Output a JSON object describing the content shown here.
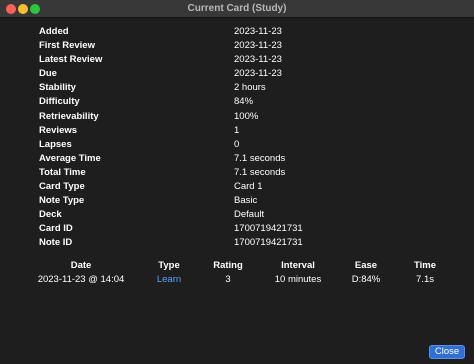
{
  "window": {
    "title": "Current Card (Study)"
  },
  "stats": [
    {
      "label": "Added",
      "value": "2023-11-23"
    },
    {
      "label": "First Review",
      "value": "2023-11-23"
    },
    {
      "label": "Latest Review",
      "value": "2023-11-23"
    },
    {
      "label": "Due",
      "value": "2023-11-23"
    },
    {
      "label": "Stability",
      "value": "2 hours"
    },
    {
      "label": "Difficulty",
      "value": "84%"
    },
    {
      "label": "Retrievability",
      "value": "100%"
    },
    {
      "label": "Reviews",
      "value": "1"
    },
    {
      "label": "Lapses",
      "value": "0"
    },
    {
      "label": "Average Time",
      "value": "7.1 seconds"
    },
    {
      "label": "Total Time",
      "value": "7.1 seconds"
    },
    {
      "label": "Card Type",
      "value": "Card 1"
    },
    {
      "label": "Note Type",
      "value": "Basic"
    },
    {
      "label": "Deck",
      "value": "Default"
    },
    {
      "label": "Card ID",
      "value": "1700719421731"
    },
    {
      "label": "Note ID",
      "value": "1700719421731"
    }
  ],
  "revlog": {
    "headers": {
      "date": "Date",
      "type": "Type",
      "rating": "Rating",
      "interval": "Interval",
      "ease": "Ease",
      "time": "Time"
    },
    "rows": [
      {
        "date": "2023-11-23 @ 14:04",
        "type": "Learn",
        "rating": "3",
        "interval": "10 minutes",
        "ease": "D:84%",
        "time": "7.1s"
      }
    ]
  },
  "buttons": {
    "close": "Close"
  },
  "colors": {
    "link": "#5aa2ff",
    "accent": "#2f6fd6",
    "background": "#1e1e1e"
  }
}
